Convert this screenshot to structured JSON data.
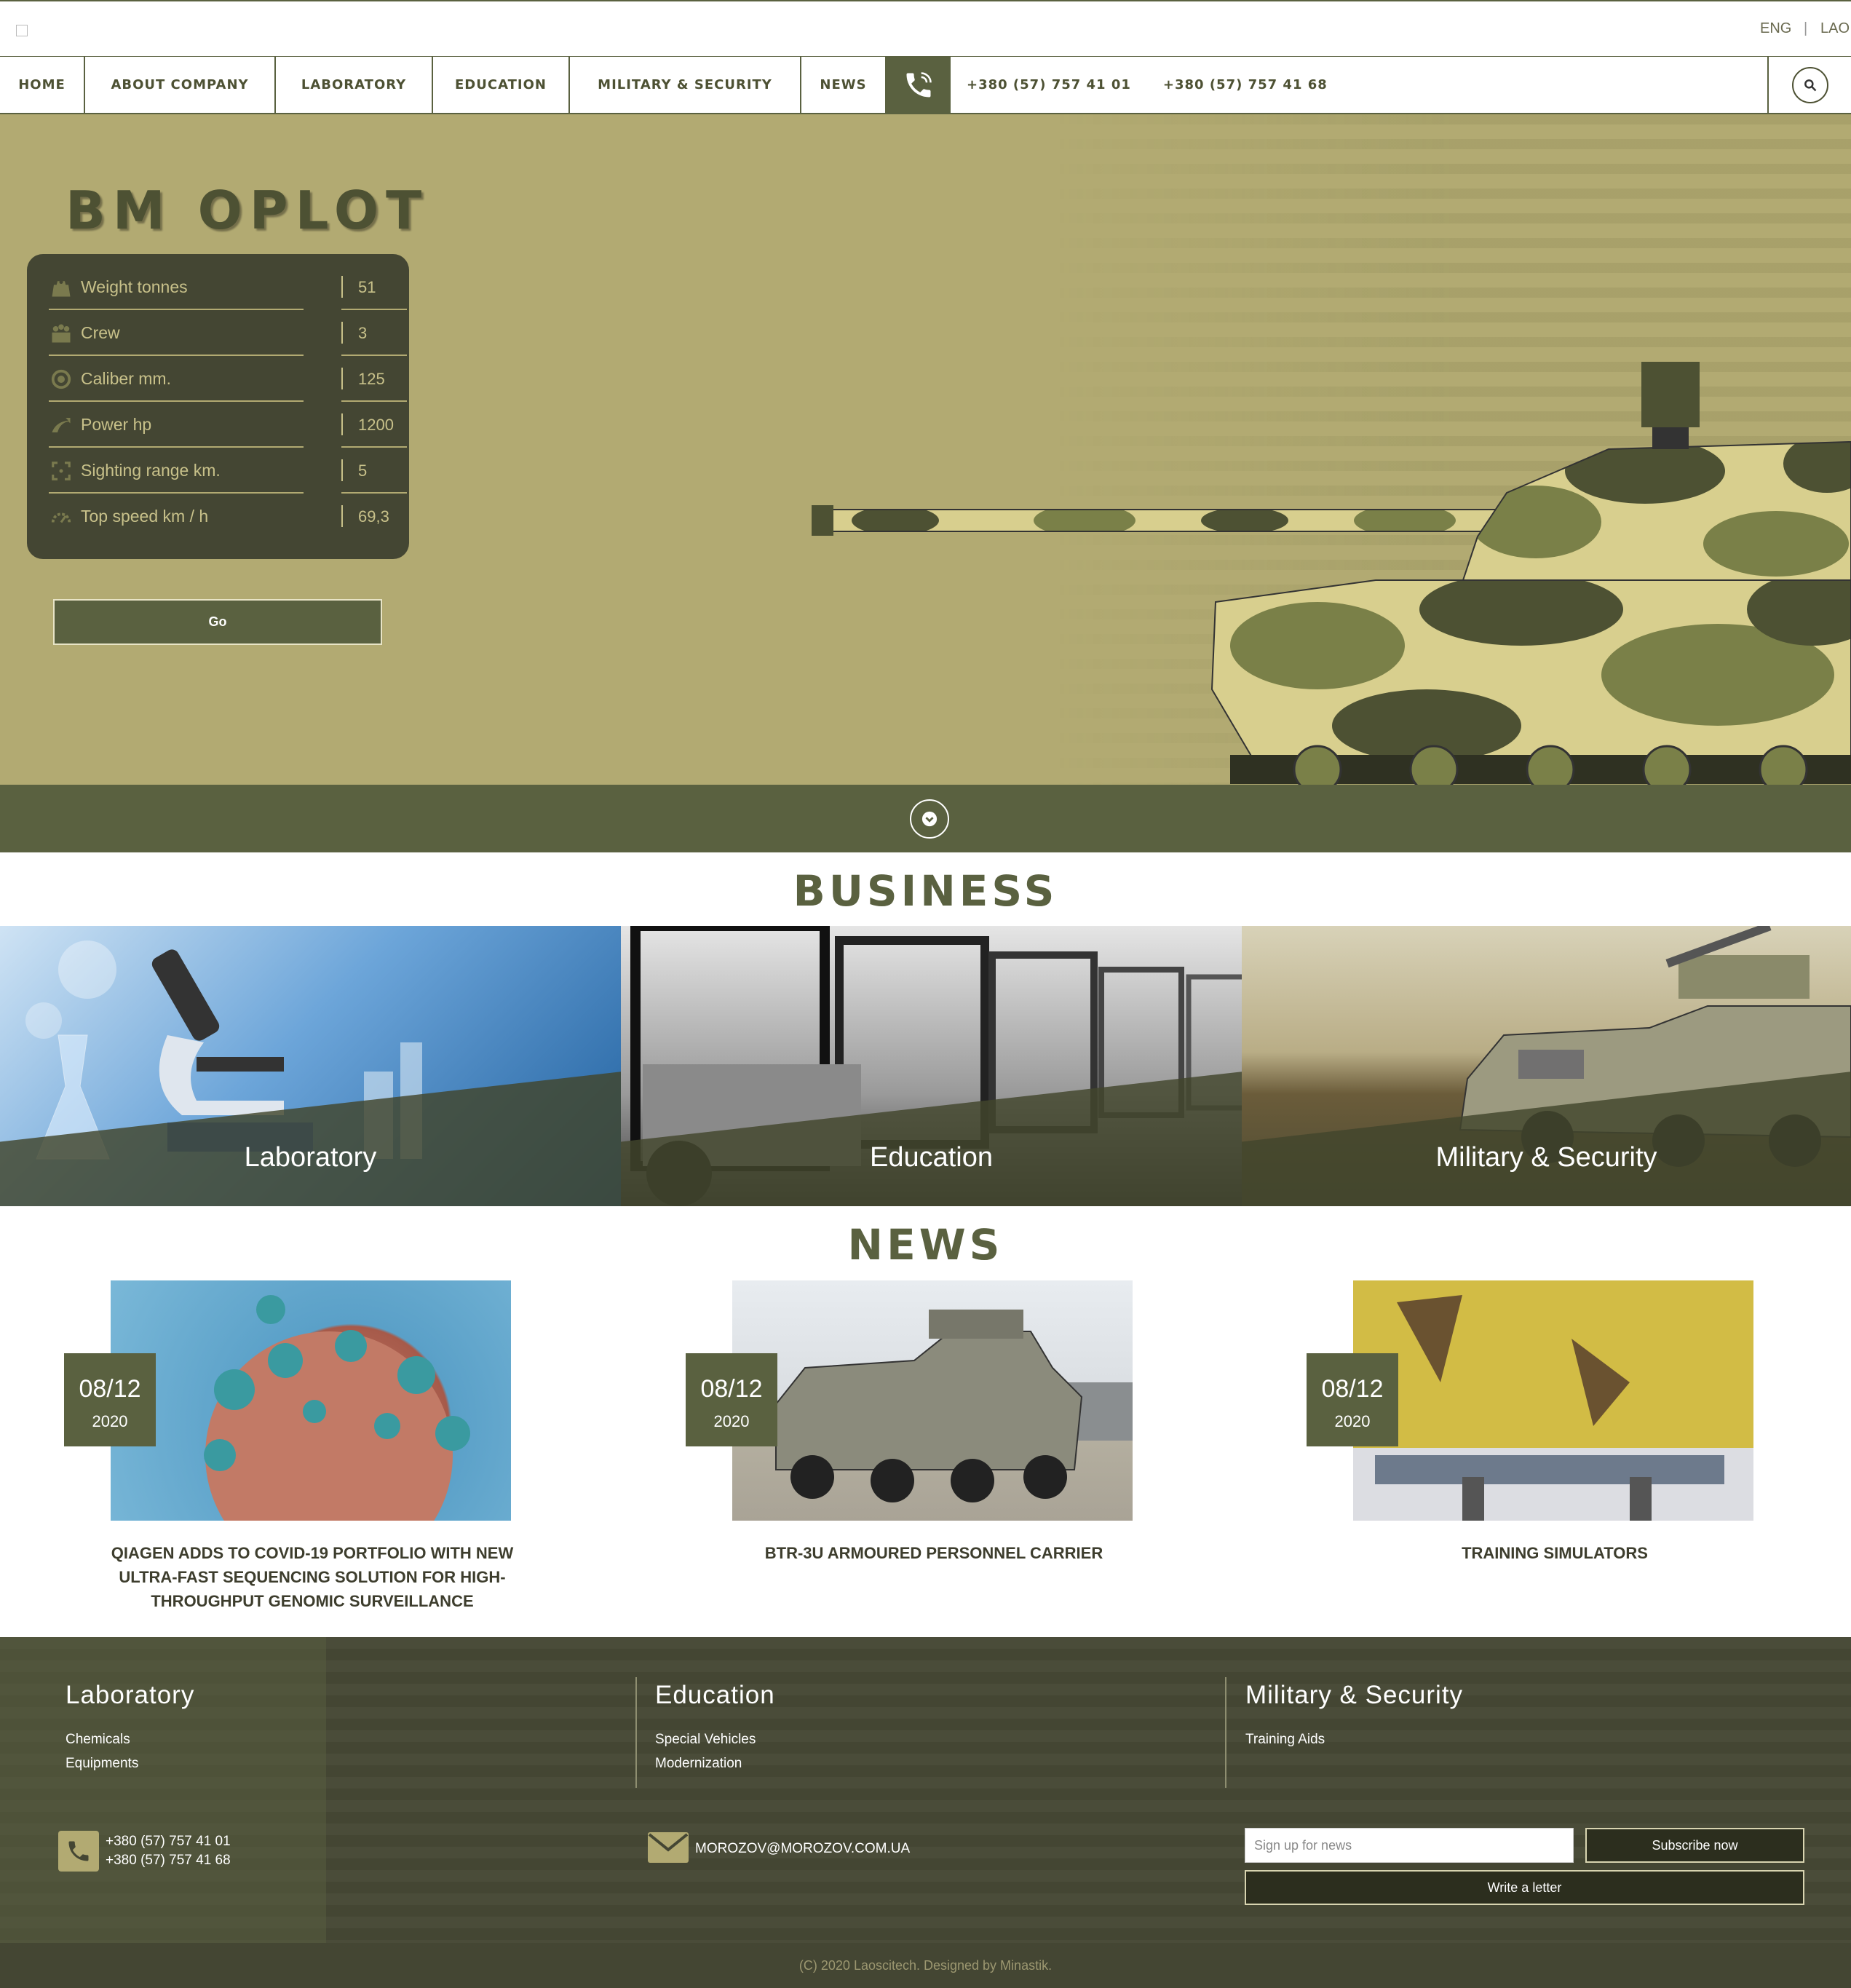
{
  "header": {
    "languages": [
      "ENG",
      "|",
      "LAO"
    ]
  },
  "nav": {
    "items": [
      "HOME",
      "ABOUT COMPANY",
      "LABORATORY",
      "EDUCATION",
      "MILITARY & SECURITY",
      "NEWS"
    ],
    "phones": [
      "+380 (57) 757 41 01",
      "+380 (57) 757 41 68"
    ],
    "icons": {
      "phone": "phone-icon",
      "search": "search-icon"
    }
  },
  "hero": {
    "title": "BM OPLOT",
    "specs": [
      {
        "label": "Weight tonnes",
        "value": "51",
        "icon": "weight-icon"
      },
      {
        "label": "Crew",
        "value": "3",
        "icon": "crew-icon"
      },
      {
        "label": "Caliber mm.",
        "value": "125",
        "icon": "caliber-icon"
      },
      {
        "label": "Power hp",
        "value": "1200",
        "icon": "power-icon"
      },
      {
        "label": "Sighting range km.",
        "value": "5",
        "icon": "sighting-icon"
      },
      {
        "label": "Top speed km / h",
        "value": "69,3",
        "icon": "speed-icon"
      }
    ],
    "button": "Go"
  },
  "business": {
    "title": "BUSINESS",
    "cards": [
      "Laboratory",
      "Education",
      "Military & Security"
    ]
  },
  "news": {
    "title": "NEWS",
    "items": [
      {
        "day": "08/12",
        "year": "2020",
        "title": "QIAGEN ADDS TO COVID-19 PORTFOLIO WITH NEW ULTRA-FAST SEQUENCING SOLUTION FOR HIGH-THROUGHPUT GENOMIC SURVEILLANCE"
      },
      {
        "day": "08/12",
        "year": "2020",
        "title": "BTR-3U ARMOURED PERSONNEL CARRIER"
      },
      {
        "day": "08/12",
        "year": "2020",
        "title": "TRAINING SIMULATORS"
      }
    ]
  },
  "footer": {
    "columns": [
      {
        "title": "Laboratory",
        "links": [
          "Chemicals",
          "Equipments"
        ]
      },
      {
        "title": "Education",
        "links": [
          "Special Vehicles",
          "Modernization"
        ]
      },
      {
        "title": "Military & Security",
        "links": [
          "Training Aids"
        ]
      }
    ],
    "phones": [
      "+380 (57) 757 41 01",
      "+380 (57) 757 41 68"
    ],
    "email": "MOROZOV@MOROZOV.COM.UA",
    "subscribe_placeholder": "Sign up for news",
    "subscribe_button": "Subscribe now",
    "write_button": "Write a letter",
    "copyright": "(C) 2020 Laoscitech. Designed by Minastik."
  },
  "colors": {
    "olive": "#5a6140",
    "khaki": "#b2aa72",
    "dark": "#444633"
  }
}
